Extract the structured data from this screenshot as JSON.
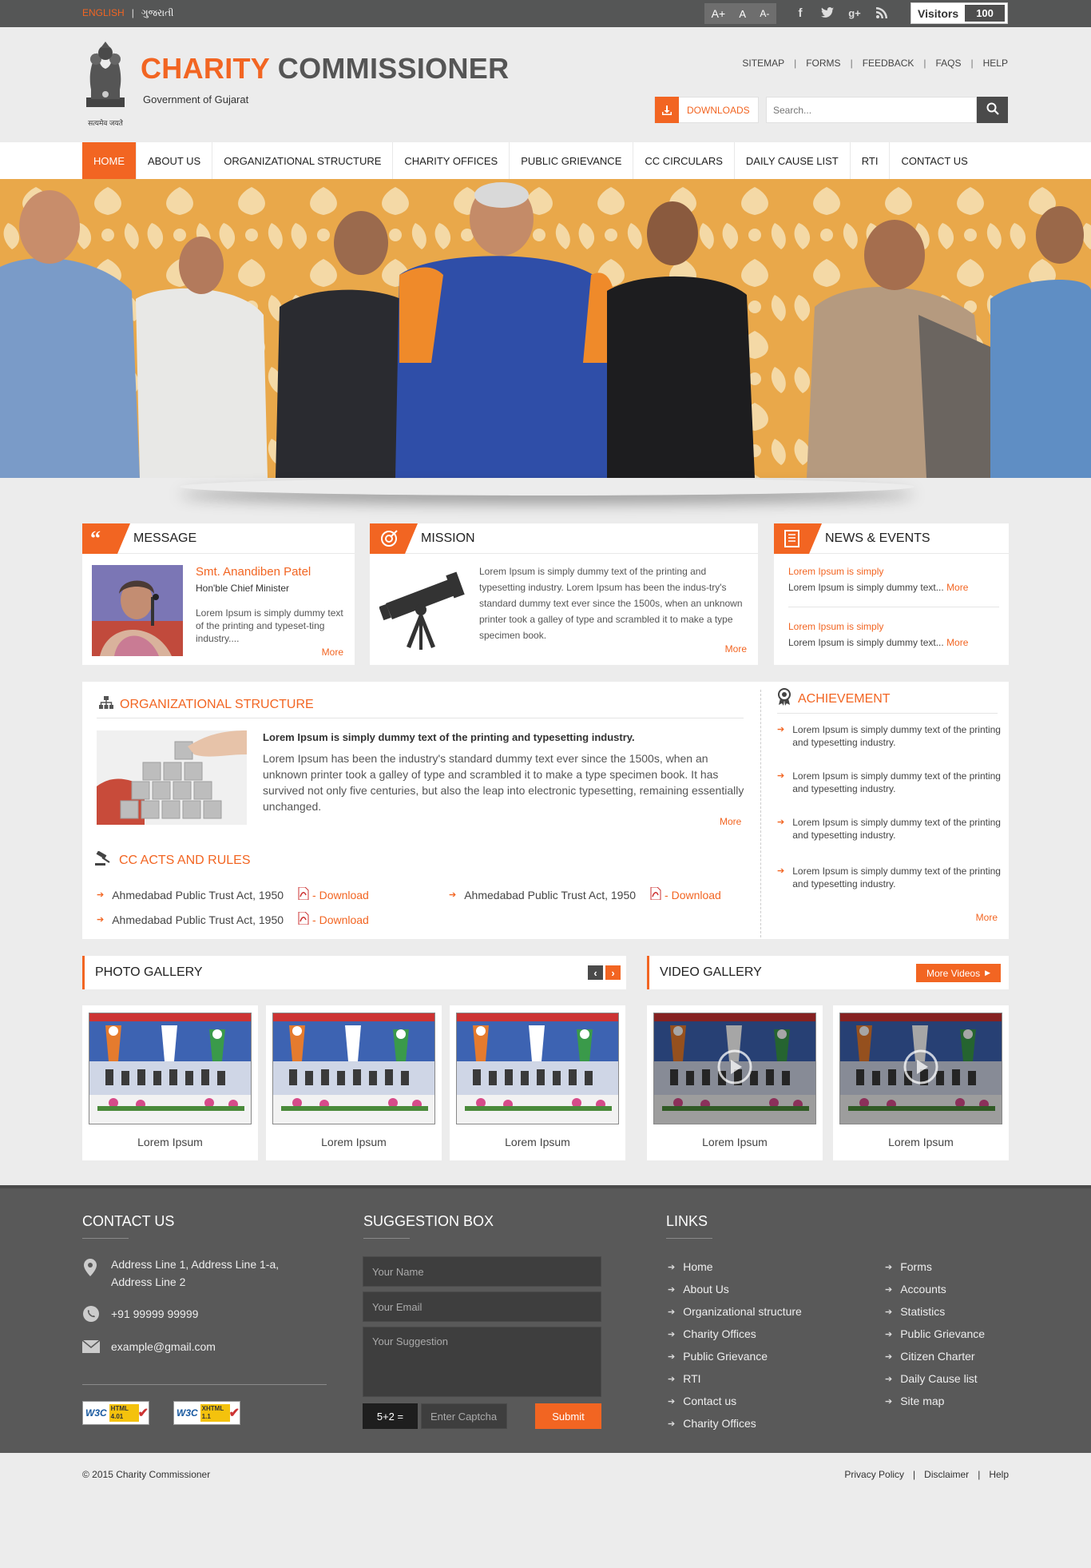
{
  "topbar": {
    "lang_english": "ENGLISH",
    "lang_sep": "|",
    "lang_gujarati": "ગુજરાતી",
    "font_larger": "A+",
    "font_normal": "A",
    "font_smaller": "A-",
    "visitors_label": "Visitors",
    "visitors_count": "100",
    "social_icons": [
      "facebook-icon",
      "twitter-icon",
      "google-plus-icon",
      "rss-icon"
    ]
  },
  "header": {
    "emblem_caption": "सत्यमेव जयते",
    "title_part1": "CHARITY",
    "title_part2": "COMMISSIONER",
    "subtitle": "Government of Gujarat",
    "links": [
      "SITEMAP",
      "FORMS",
      "FEEDBACK",
      "FAQS",
      "HELP"
    ],
    "downloads_label": "DOWNLOADS",
    "search_placeholder": "Search..."
  },
  "nav": [
    "HOME",
    "ABOUT US",
    "ORGANIZATIONAL STRUCTURE",
    "CHARITY OFFICES",
    "PUBLIC GRIEVANCE",
    "CC CIRCULARS",
    "DAILY CAUSE LIST",
    "RTI",
    "CONTACT US"
  ],
  "message": {
    "title": "MESSAGE",
    "name": "Smt. Anandiben Patel",
    "role": "Hon'ble Chief Minister",
    "text": "Lorem Ipsum is simply dummy text of the printing and typeset-ting industry....",
    "more": "More"
  },
  "mission": {
    "title": "MISSION",
    "text": "Lorem Ipsum is simply dummy text of the printing and typesetting industry. Lorem Ipsum has been the indus-try's standard dummy text ever since the 1500s, when an unknown printer took a galley of type and scrambled it to make a type specimen book.",
    "more": "More"
  },
  "news": {
    "title": "NEWS & EVENTS",
    "items": [
      {
        "heading": "Lorem Ipsum is simply",
        "text": "Lorem Ipsum is simply dummy text...",
        "more": "More"
      },
      {
        "heading": "Lorem Ipsum is simply",
        "text": "Lorem Ipsum is simply dummy text...",
        "more": "More"
      }
    ]
  },
  "org": {
    "title": "ORGANIZATIONAL STRUCTURE",
    "lead": "Lorem Ipsum is simply dummy text of the printing and typesetting industry.",
    "text": "Lorem Ipsum has been the industry's standard dummy text ever since the 1500s, when an unknown printer took a galley of type and scrambled it to make a type specimen book. It has survived not only five centuries, but also the leap into electronic typesetting, remaining essentially unchanged.",
    "more": "More"
  },
  "acts": {
    "title": "CC ACTS AND RULES",
    "items": [
      {
        "name": "Ahmedabad Public Trust Act, 1950",
        "link": "- Download"
      },
      {
        "name": "Ahmedabad Public Trust Act, 1950",
        "link": "- Download"
      },
      {
        "name": "Ahmedabad Public Trust Act, 1950",
        "link": "- Download"
      }
    ]
  },
  "achievement": {
    "title": "ACHIEVEMENT",
    "items": [
      "Lorem Ipsum is simply dummy text of the printing and typesetting industry.",
      "Lorem Ipsum is simply dummy text of the printing and typesetting industry.",
      "Lorem Ipsum is simply dummy text of the printing and typesetting industry.",
      "Lorem Ipsum is simply dummy text of the printing and typesetting industry."
    ],
    "more": "More"
  },
  "photo_gallery": {
    "title": "PHOTO GALLERY",
    "captions": [
      "Lorem Ipsum",
      "Lorem Ipsum",
      "Lorem Ipsum"
    ]
  },
  "video_gallery": {
    "title": "VIDEO GALLERY",
    "more_button": "More Videos",
    "captions": [
      "Lorem Ipsum",
      "Lorem Ipsum"
    ]
  },
  "footer": {
    "contact_title": "CONTACT US",
    "address": "Address Line 1, Address Line 1-a, Address Line 2",
    "phone": "+91 99999 99999",
    "email": "example@gmail.com",
    "badge_html": "HTML 4.01",
    "badge_xhtml": "XHTML 1.1",
    "suggestion_title": "SUGGESTION BOX",
    "name_placeholder": "Your Name",
    "email_placeholder": "Your Email",
    "suggestion_placeholder": "Your Suggestion",
    "captcha": "5+2 =",
    "captcha_placeholder": "Enter Captcha",
    "submit": "Submit",
    "links_title": "LINKS",
    "links_col1": [
      "Home",
      "About Us",
      "Organizational structure",
      "Charity Offices",
      "Public Grievance",
      "RTI",
      "Contact us",
      "Charity Offices"
    ],
    "links_col2": [
      "Forms",
      "Accounts",
      "Statistics",
      "Public Grievance",
      "Citizen Charter",
      "Daily Cause list",
      "Site map"
    ]
  },
  "bottom": {
    "copyright": "© 2015 Charity Commissioner",
    "links": [
      "Privacy Policy",
      "Disclaimer",
      "Help"
    ]
  },
  "colors": {
    "accent": "#f26522",
    "dark": "#555656",
    "footer": "#595959"
  }
}
